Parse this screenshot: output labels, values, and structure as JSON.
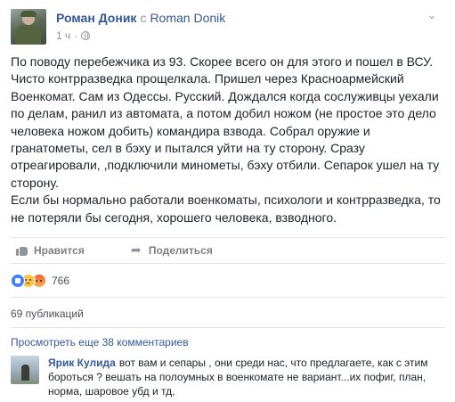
{
  "post": {
    "author": "Роман Доник",
    "with_label": "с",
    "coauthor": "Roman Donik",
    "time": "1 ч",
    "privacy_icon": "globe-icon",
    "menu_icon": "chevron-down-icon",
    "text": "По поводу перебежчика из 93. Скорее всего он для этого и пошел в ВСУ.\nЧисто контрразведка прощелкала. Пришел через Красноармейский\nВоенкомат. Сам из Одессы. Русский. Дождался когда сослуживцы уехали\nпо делам, ранил из автомата, а потом добил ножом (не простое это дело\nчеловека ножом добить) командира взвода. Собрал оружие и\nгранатометы, сел в бэху и пытался уйти на ту сторону. Сразу\nотреагировали, ,подключили минометы, бэху отбили. Сепарок ушел на ту\nсторону.\nЕсли бы нормально работали военкоматы, психологи и контрразведка, то\nне потеряли бы сегодня, хорошего человека, взводного."
  },
  "actions": {
    "like_label": "Нравится",
    "share_label": "Поделиться"
  },
  "reactions": {
    "types": [
      "like",
      "sad",
      "angry"
    ],
    "count": "766"
  },
  "shares": "69 публикаций",
  "comments": {
    "view_more": "Просмотреть еще 38 комментариев",
    "items": [
      {
        "author": "Ярик Кулида",
        "text": "вот вам и сепары , они среди нас, что предлагаете, как с этим бороться ? вешать на полоумных в военкомате не вариант...их пофиг, план, норма, шаровое убд и тд,"
      }
    ]
  },
  "colors": {
    "link": "#365899",
    "text": "#1d2129",
    "muted": "#90949c",
    "like_blue": "#4080ff"
  }
}
